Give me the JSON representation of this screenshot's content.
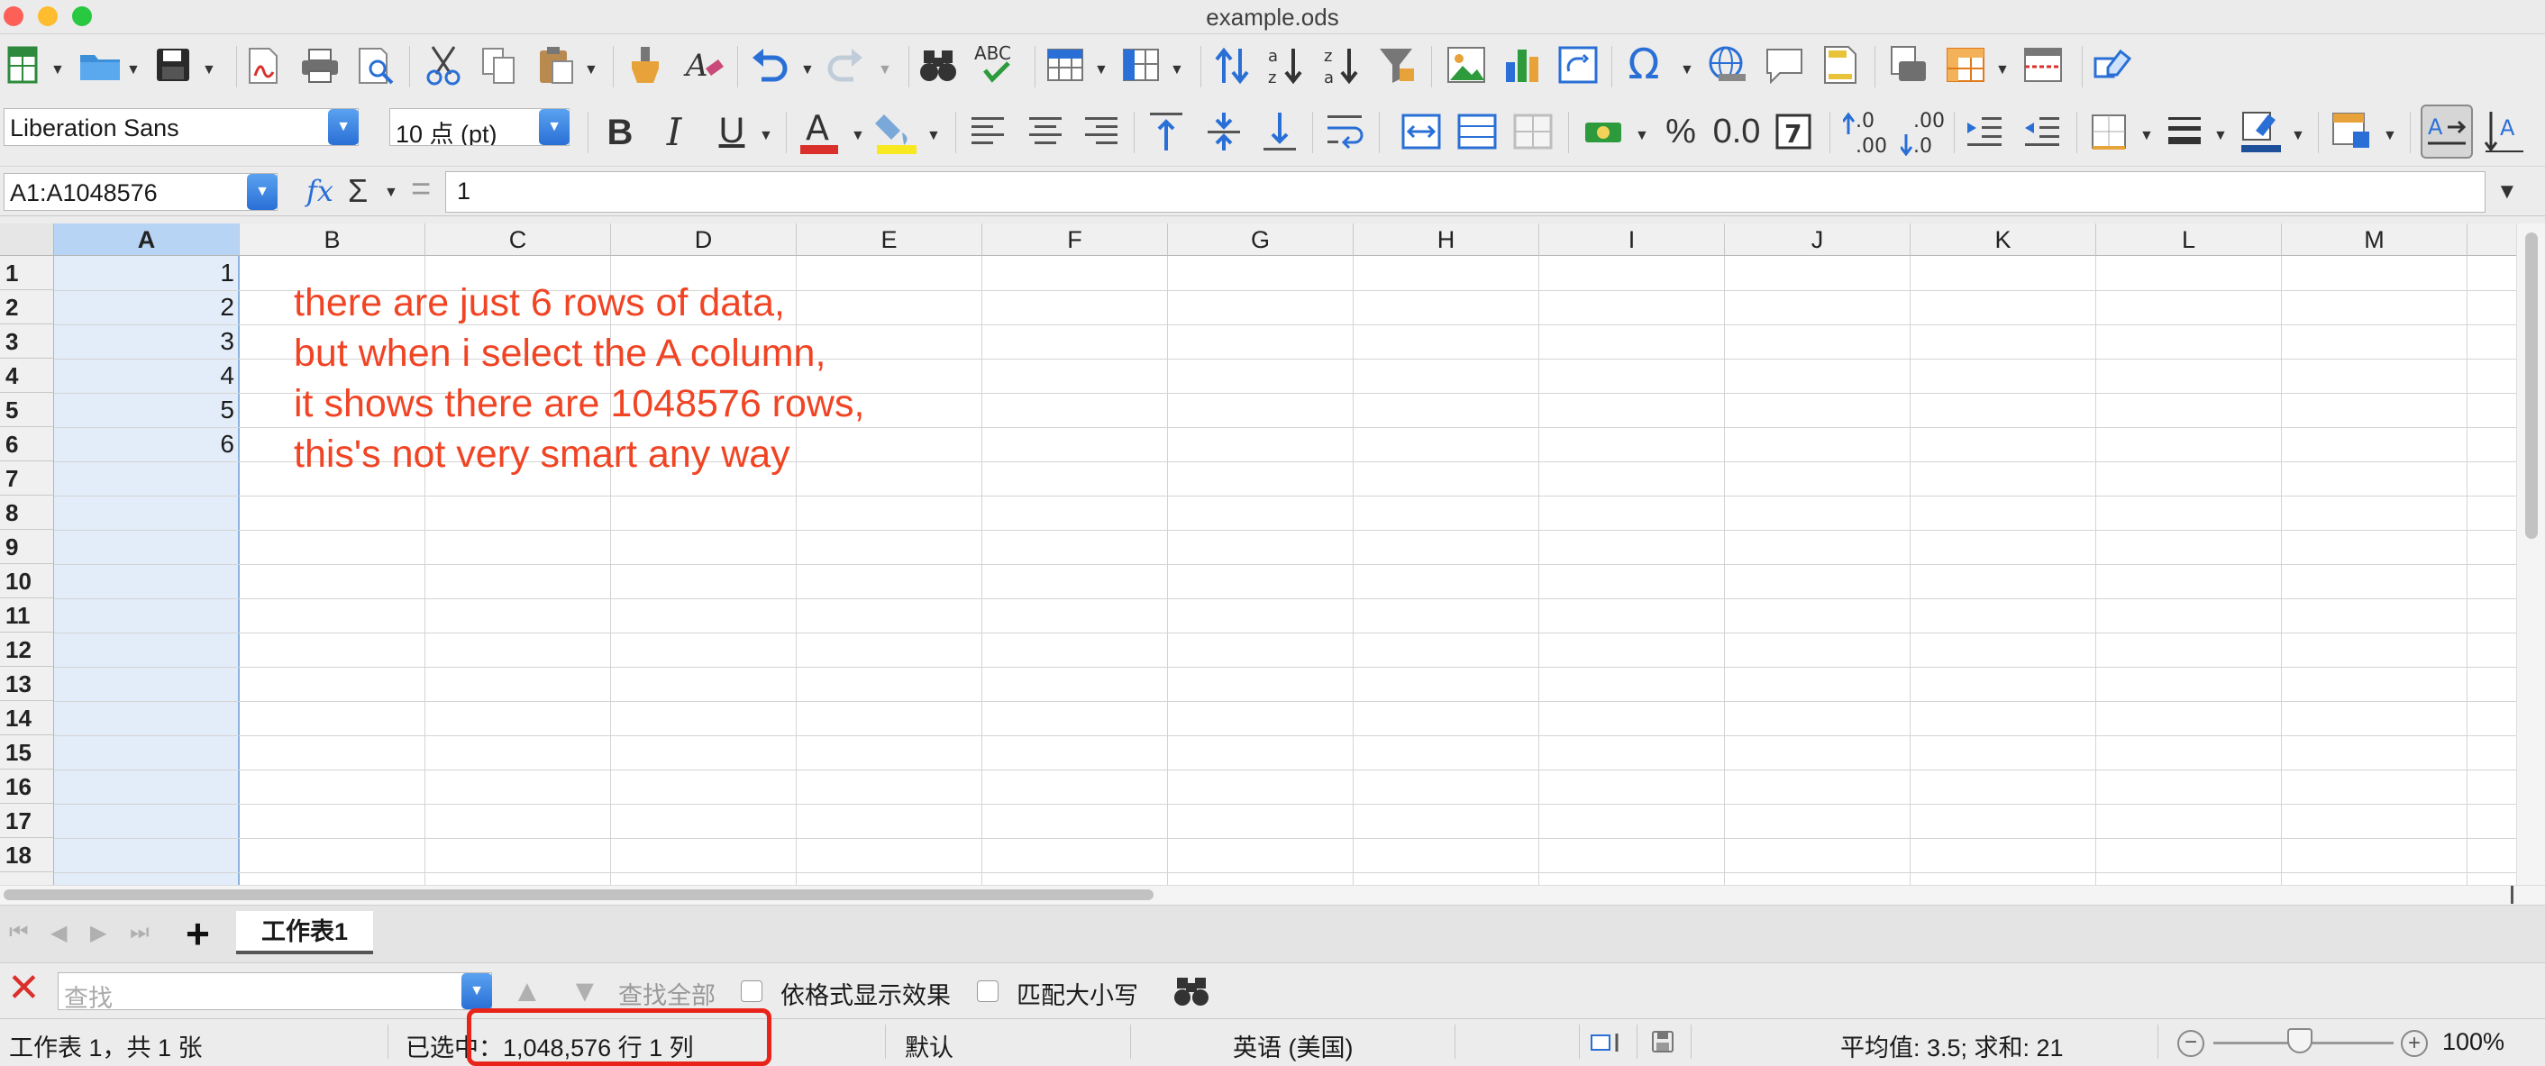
{
  "window": {
    "title": "example.ods"
  },
  "formatting": {
    "font_name": "Liberation Sans",
    "font_size": "10 点 (pt)"
  },
  "formula_bar": {
    "name_box": "A1:A1048576",
    "fx_symbol": "fx",
    "sum_symbol": "Σ",
    "equals_symbol": "=",
    "content": "1"
  },
  "grid": {
    "columns": [
      "A",
      "B",
      "C",
      "D",
      "E",
      "F",
      "G",
      "H",
      "I",
      "J",
      "K",
      "L",
      "M"
    ],
    "rows": [
      "1",
      "2",
      "3",
      "4",
      "5",
      "6",
      "7",
      "8",
      "9",
      "10",
      "11",
      "12",
      "13",
      "14",
      "15",
      "16",
      "17",
      "18"
    ],
    "column_a_values": [
      "1",
      "2",
      "3",
      "4",
      "5",
      "6"
    ],
    "selected_column": "A"
  },
  "annotation": {
    "lines": [
      "there are just 6 rows of data,",
      "but when i select the A column,",
      "it shows there are 1048576 rows,",
      "this's not very smart any way"
    ],
    "color": "#f04424"
  },
  "sheet_tabs": {
    "add_label": "+",
    "tabs": [
      "工作表1"
    ]
  },
  "find_bar": {
    "placeholder": "查找",
    "find_all": "查找全部",
    "formatted_display": "依格式显示效果",
    "match_case": "匹配大小写"
  },
  "status_bar": {
    "sheet_info": "工作表 1，共 1 张",
    "selection": "已选中：1,048,576 行 1 列",
    "page_style": "默认",
    "language": "英语 (美国)",
    "aggregate": "平均值: 3.5; 求和: 21",
    "zoom": "100%"
  },
  "colors": {
    "selection_header": "#b8d4f5",
    "selection_fill": "#e2edf9",
    "highlight_box": "#e8231a"
  }
}
